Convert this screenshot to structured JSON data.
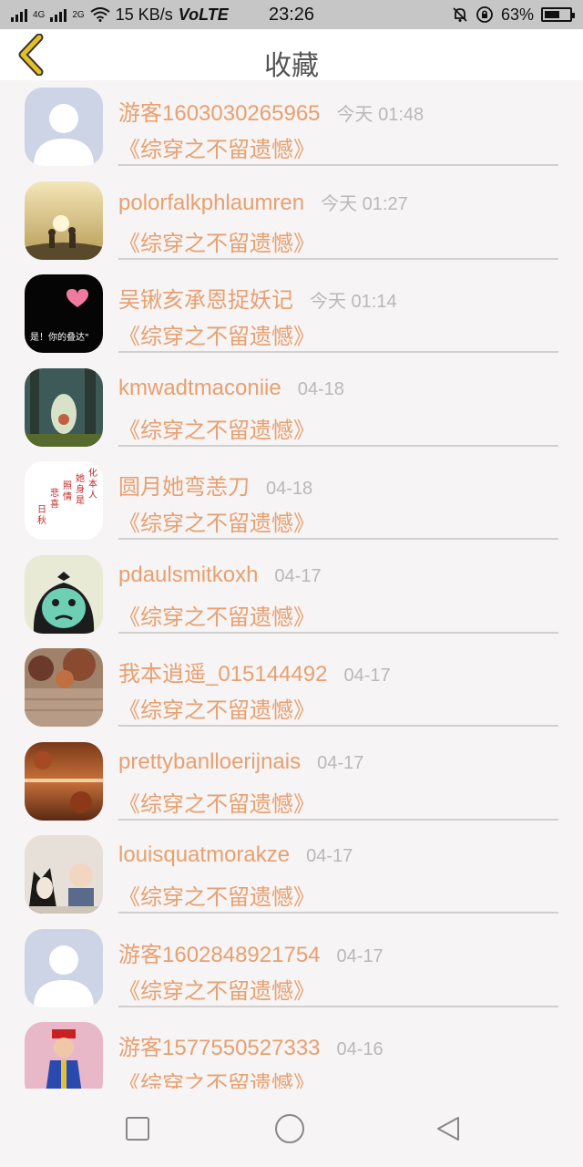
{
  "status_bar": {
    "left_network_1": "4G",
    "left_network_2": "2G",
    "speed": "15 KB/s",
    "volte": "VoLTE",
    "time": "23:26",
    "battery_text": "63%",
    "battery_level": 0.63,
    "icons": [
      "signal-icon",
      "wifi-icon",
      "mute-icon",
      "lock-rotation-icon",
      "battery-icon"
    ]
  },
  "header": {
    "title": "收藏",
    "back_icon": "chevron-left-icon"
  },
  "favorites": [
    {
      "name": "游客1603030265965",
      "time": "今天 01:48",
      "book": "《综穿之不留遗憾》",
      "avatar": "default"
    },
    {
      "name": "polorfalkphlaumren",
      "time": "今天 01:27",
      "book": "《综穿之不留遗憾》",
      "avatar": "sunset"
    },
    {
      "name": "吴锹亥承恩捉妖记",
      "time": "今天 01:14",
      "book": "《综穿之不留遗憾》",
      "avatar": "dark-heart"
    },
    {
      "name": "kmwadtmaconiie",
      "time": "04-18",
      "book": "《综穿之不留遗憾》",
      "avatar": "forest"
    },
    {
      "name": "圆月她弯恙刀",
      "time": "04-18",
      "book": "《综穿之不留遗憾》",
      "avatar": "calligraphy"
    },
    {
      "name": "pdaulsmitkoxh",
      "time": "04-17",
      "book": "《综穿之不留遗憾》",
      "avatar": "monkey"
    },
    {
      "name": "我本逍遥_015144492",
      "time": "04-17",
      "book": "《综穿之不留遗憾》",
      "avatar": "wall"
    },
    {
      "name": "prettybanlloerijnais",
      "time": "04-17",
      "book": "《综穿之不留遗憾》",
      "avatar": "autumn"
    },
    {
      "name": "louisquatmorakze",
      "time": "04-17",
      "book": "《综穿之不留遗憾》",
      "avatar": "dog-baby"
    },
    {
      "name": "游客1602848921754",
      "time": "04-17",
      "book": "《综穿之不留遗憾》",
      "avatar": "default"
    },
    {
      "name": "游客1577550527333",
      "time": "04-16",
      "book": "《综穿之不留遗憾》",
      "avatar": "child"
    }
  ],
  "nav_bar": {
    "icons": [
      "recent-apps-icon",
      "home-icon",
      "back-icon"
    ]
  },
  "colors": {
    "accent": "#e8a070",
    "time": "#b9b9b9",
    "back_chevron": "#e6c020",
    "divider": "#d0d0d0"
  }
}
